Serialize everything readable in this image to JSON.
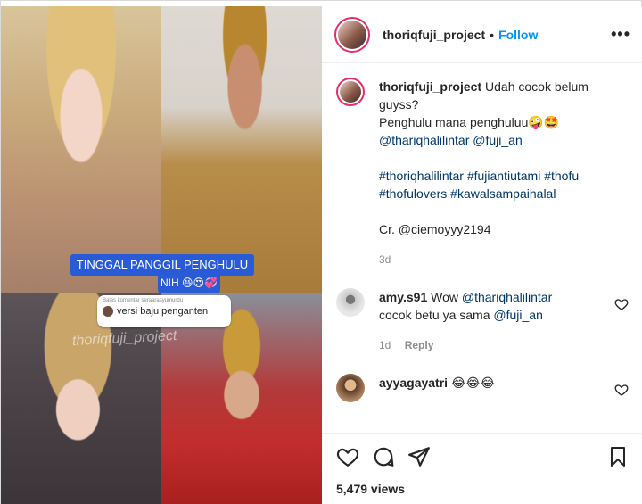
{
  "post": {
    "username": "thoriqfuji_project",
    "follow_label": "Follow",
    "separator": "•",
    "more_label": "•••"
  },
  "media": {
    "overlay_text_line1": "TINGGAL PANGGIL PENGHULU",
    "overlay_text_line2": "NIH 😆😍💞",
    "reply_small": "Balas komentar seraarasyumurdu",
    "reply_big": "versi baju penganten",
    "watermark": "thoriqfuji_project"
  },
  "caption": {
    "username": "thoriqfuji_project",
    "line1": "Udah cocok belum",
    "line2": "guyss?",
    "line3": "Penghulu mana penghuluu🤪🤩",
    "mention1": "@thariqhalilintar",
    "mention2": "@fuji_an",
    "hashtags1": "#thoriqhalilintar #fujiantiutami #thofu",
    "hashtags2": "#thofulovers #kawalsampaihalal",
    "credit": "Cr. @ciemoyyy2194",
    "time": "3d"
  },
  "comments": [
    {
      "username": "amy.s91",
      "text_pre": "Wow",
      "mention": "@thariqhalilintar",
      "text_mid": "cocok betu ya sama",
      "mention2": "@fuji_an",
      "time": "1d",
      "reply_label": "Reply"
    },
    {
      "username": "ayyagayatri",
      "text": "😂😂😂"
    }
  ],
  "actions": {
    "icons": [
      "heart-icon",
      "comment-icon",
      "share-icon",
      "save-icon"
    ],
    "views": "5,479 views"
  },
  "colors": {
    "follow": "#0095f6",
    "link": "#00376b",
    "muted": "#8e8e8e",
    "caption_box": "#2a5bd6"
  }
}
